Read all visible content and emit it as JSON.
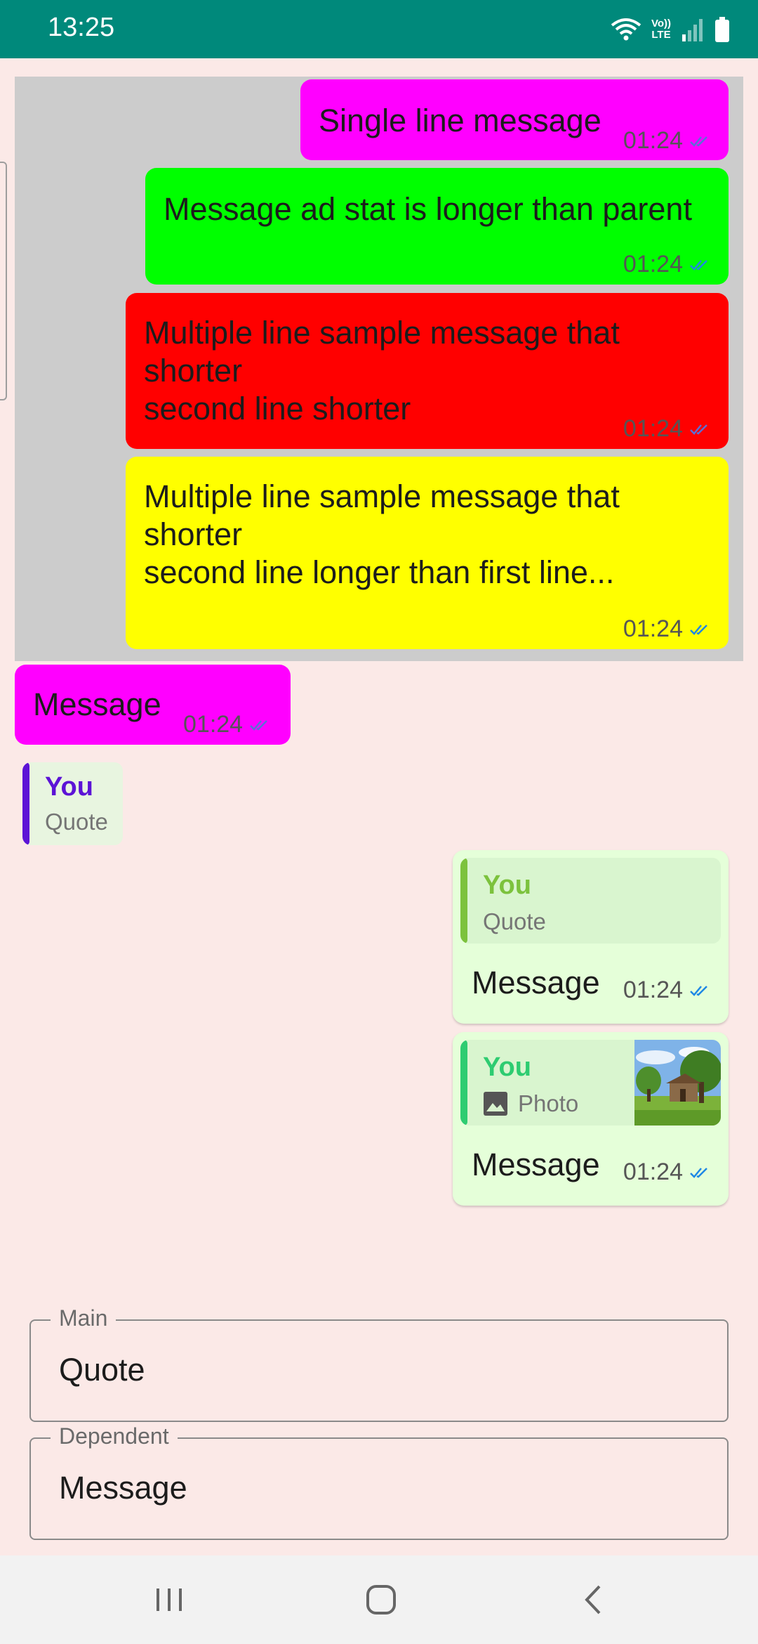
{
  "status_bar": {
    "time": "13:25",
    "lte_top": "Vo))",
    "lte_bottom": "LTE",
    "icons": [
      "wifi-icon",
      "volte-icon",
      "signal-icon",
      "battery-icon"
    ]
  },
  "group_messages": [
    {
      "text": "Single line message",
      "time": "01:24",
      "color": "#ff00ff"
    },
    {
      "text": "Message ad stat is longer than parent",
      "time": "01:24",
      "color": "#00ff00"
    },
    {
      "text": "Multiple line sample message that\nshorter\nsecond line shorter",
      "time": "01:24",
      "color": "#ff0000"
    },
    {
      "text": "Multiple line sample message that\nshorter\nsecond line longer than first line...",
      "time": "01:24",
      "color": "#ffff00"
    }
  ],
  "single_message": {
    "text": "Message",
    "time": "01:24",
    "color": "#ff00ff"
  },
  "quote_small": {
    "name": "You",
    "text": "Quote",
    "accent": "#5c13d6"
  },
  "quoted_messages": [
    {
      "quote_name": "You",
      "quote_text": "Quote",
      "text": "Message",
      "time": "01:24",
      "accent": "#7cc23d"
    },
    {
      "quote_name": "You",
      "quote_text": "Photo",
      "quote_icon": "image-icon",
      "text": "Message",
      "time": "01:24",
      "accent": "#2ecc71"
    }
  ],
  "fields": {
    "main": {
      "label": "Main",
      "value": "Quote"
    },
    "dependent": {
      "label": "Dependent",
      "value": "Message"
    }
  },
  "nav_bar": {
    "icons": [
      "recents-icon",
      "home-icon",
      "back-icon"
    ]
  },
  "colors": {
    "status_bar": "#00897b",
    "background": "#fbe9e7",
    "group_background": "#cccccc",
    "card_background": "#e5ffd9",
    "tick": "#1e88e5"
  }
}
